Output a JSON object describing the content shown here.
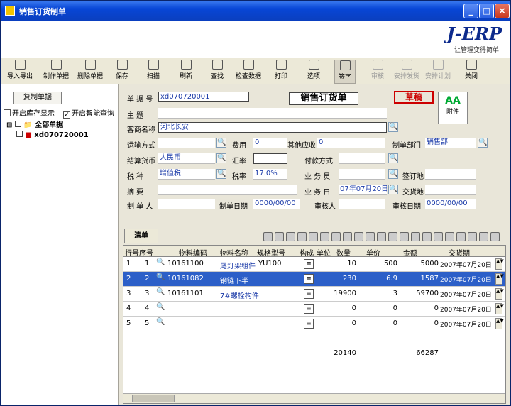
{
  "window": {
    "title": "销售订货制单",
    "min": "_",
    "max": "□",
    "close": "×"
  },
  "brand": {
    "logo": "J-ERP",
    "slogan": "让管理变得简单"
  },
  "toolbar": [
    {
      "label": "导入导出",
      "icon": "import-export-icon",
      "enabled": true
    },
    {
      "label": "制作单据",
      "icon": "make-doc-icon",
      "enabled": true
    },
    {
      "label": "删除单据",
      "icon": "delete-doc-icon",
      "enabled": true
    },
    {
      "label": "保存",
      "icon": "save-icon",
      "enabled": true
    },
    {
      "label": "扫描",
      "icon": "scan-icon",
      "enabled": true
    },
    {
      "label": "刷新",
      "icon": "refresh-icon",
      "enabled": true
    },
    {
      "label": "查找",
      "icon": "find-icon",
      "enabled": true
    },
    {
      "label": "检查数据",
      "icon": "check-data-icon",
      "enabled": true
    },
    {
      "label": "打印",
      "icon": "print-icon",
      "enabled": true
    },
    {
      "label": "选项",
      "icon": "options-icon",
      "enabled": true
    },
    {
      "label": "签字",
      "icon": "sign-icon",
      "enabled": true
    },
    {
      "label": "审核",
      "icon": "audit-icon",
      "enabled": false
    },
    {
      "label": "安排发货",
      "icon": "ship-icon",
      "enabled": false
    },
    {
      "label": "安排计划",
      "icon": "plan-icon",
      "enabled": false
    },
    {
      "label": "关闭",
      "icon": "close-doc-icon",
      "enabled": true
    }
  ],
  "left": {
    "copy_button": "复制单据",
    "show_stock": "开启库存显示",
    "smart_query": "开启智能查询",
    "tree_root": "全部单据",
    "tree_child": "xd070720001"
  },
  "form": {
    "title": "销售订货单",
    "status": "草稿",
    "attach": "附件",
    "labels": {
      "doc_no": "单 据 号",
      "subject": "主    题",
      "customer": "客商名称",
      "transport": "运输方式",
      "fee": "费用",
      "other_recv": "其他应收",
      "dept": "制单部门",
      "currency": "结算货币",
      "rate": "汇率",
      "payment": "付款方式",
      "tax": "税    种",
      "tax_rate": "税率",
      "salesman": "业 务 员",
      "sign_place": "签订地",
      "summary": "摘    要",
      "biz_date": "业 务 日",
      "deliver_place": "交货地",
      "maker": "制 单 人",
      "make_date": "制单日期",
      "auditor": "审核人",
      "audit_date": "审核日期"
    },
    "values": {
      "doc_no": "xd070720001",
      "customer": "河北长安",
      "fee": "0",
      "other_recv": "0",
      "dept": "销售部",
      "currency": "人民币",
      "tax": "增值税",
      "tax_rate": "17.0%",
      "biz_date": "07年07月20日",
      "make_date": "0000/00/00",
      "audit_date": "0000/00/00"
    }
  },
  "grid": {
    "tab": "清单",
    "headers": [
      "行号",
      "序号",
      "物料编码",
      "物料名称",
      "规格型号",
      "构成",
      "单位",
      "数量",
      "单价",
      "金额",
      "交货期"
    ],
    "rows": [
      {
        "line": "1",
        "seq": "1",
        "code": "10161100",
        "name": "尾灯架组件",
        "spec": "YU100",
        "qty": "10",
        "price": "500",
        "amount": "5000",
        "date": "2007年07月20日"
      },
      {
        "line": "2",
        "seq": "2",
        "code": "10161082",
        "name": "钢链下半",
        "spec": "",
        "qty": "230",
        "price": "6.9",
        "amount": "1587",
        "date": "2007年07月20日"
      },
      {
        "line": "3",
        "seq": "3",
        "code": "10161101",
        "name": "7#螺栓构件",
        "spec": "",
        "qty": "19900",
        "price": "3",
        "amount": "59700",
        "date": "2007年07月20日"
      },
      {
        "line": "4",
        "seq": "4",
        "code": "",
        "name": "",
        "spec": "",
        "qty": "0",
        "price": "0",
        "amount": "0",
        "date": "2007年07月20日"
      },
      {
        "line": "5",
        "seq": "5",
        "code": "",
        "name": "",
        "spec": "",
        "qty": "0",
        "price": "0",
        "amount": "0",
        "date": "2007年07月20日"
      }
    ],
    "totals": {
      "qty": "20140",
      "amount": "66287"
    }
  }
}
